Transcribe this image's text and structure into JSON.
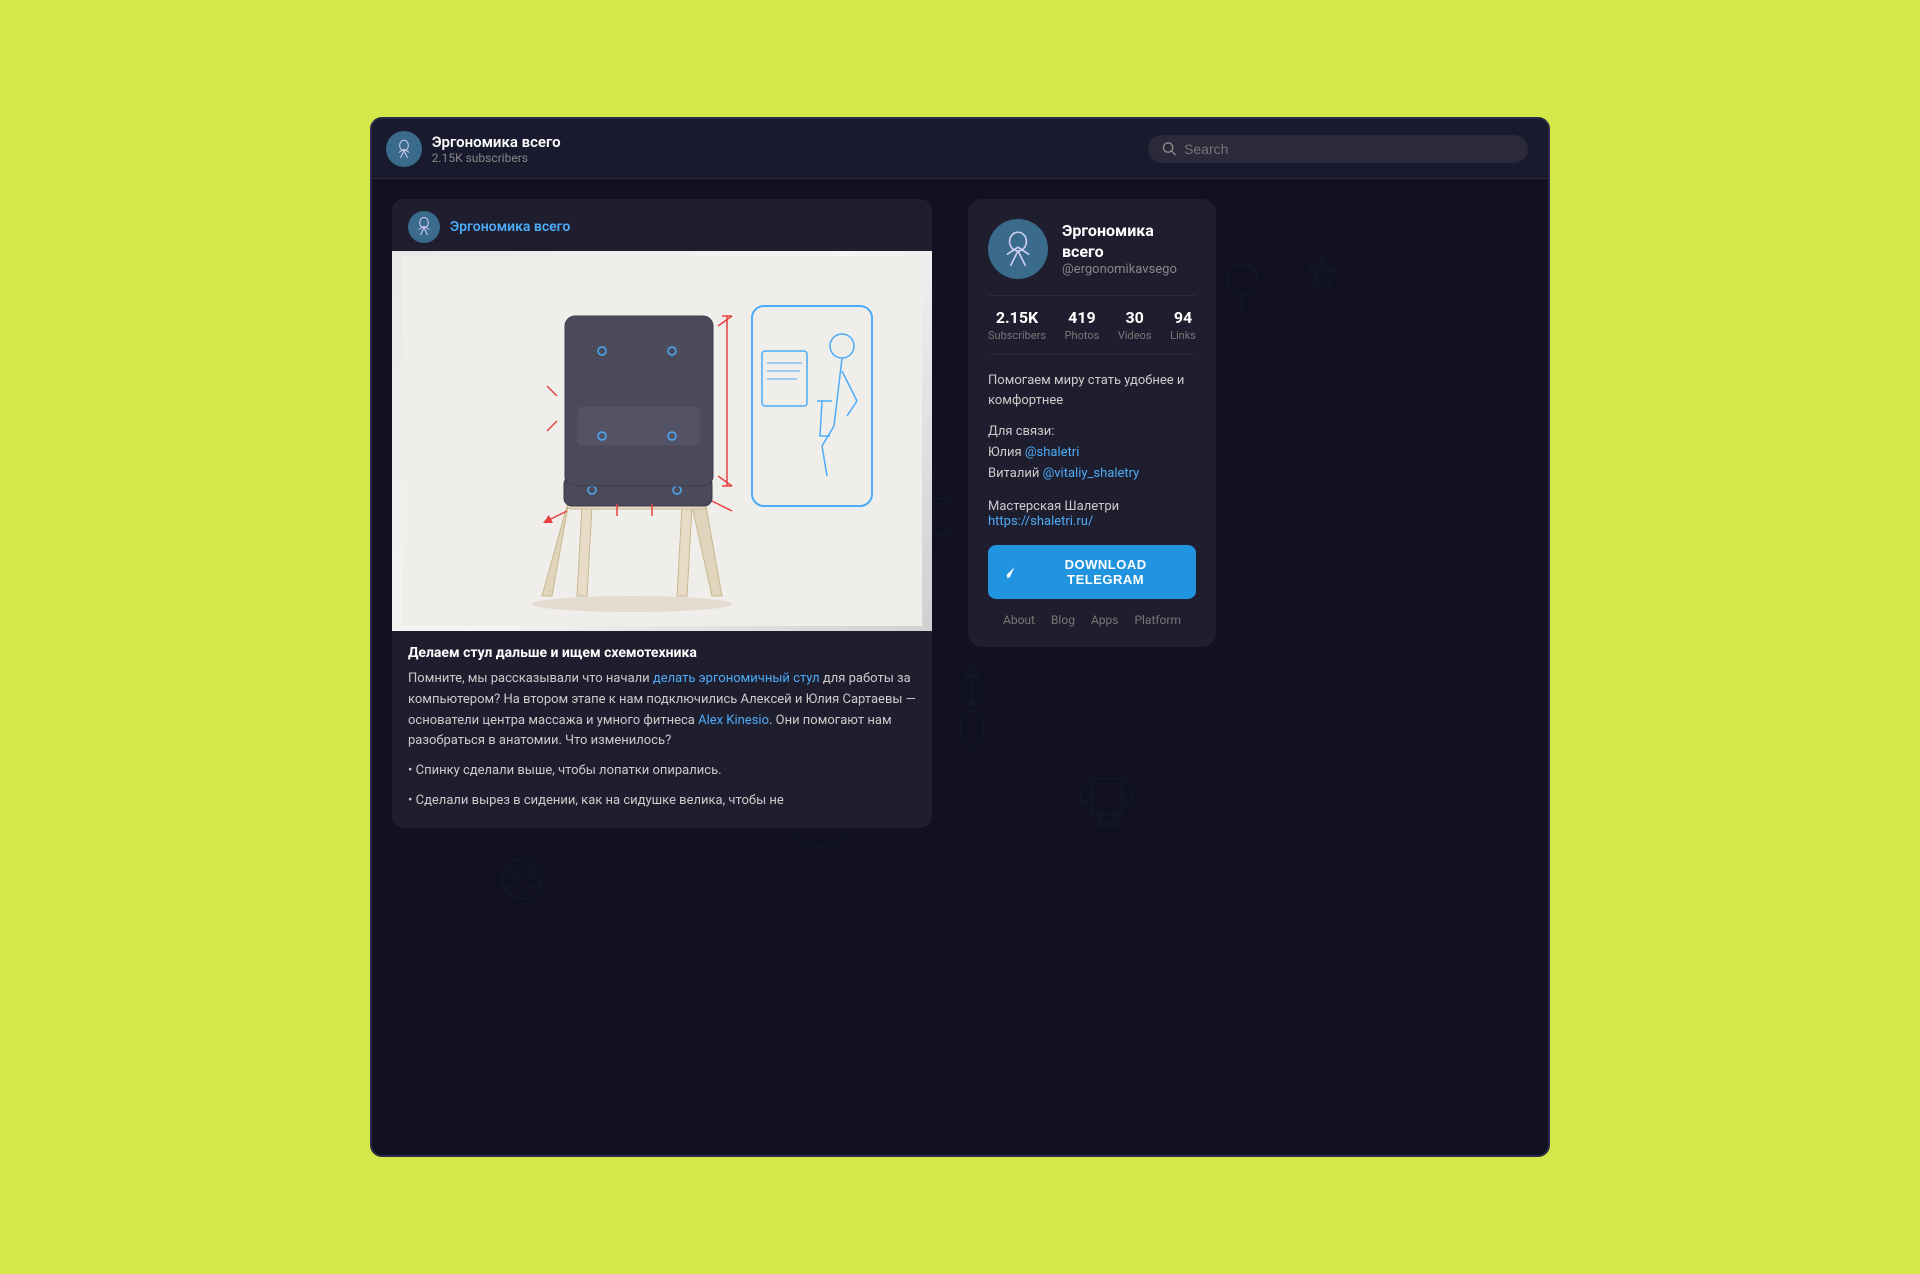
{
  "window": {
    "background": "#d4e84a"
  },
  "titlebar": {
    "channel_name": "Эргономика всего",
    "subscribers": "2.15K subscribers",
    "search_placeholder": "Search"
  },
  "post": {
    "channel_name": "Эргономика всего",
    "title": "Делаем стул дальше и ищем схемотехника",
    "body_1": "Помните, мы рассказывали что начали ",
    "link_1": "делать эргономичный стул",
    "body_2": " для работы за компьютером? На втором этапе к нам подключились Алексей и Юлия Сартаевы — основатели центра массажа и умного фитнеса ",
    "link_2": "Alex Kinesio",
    "body_3": ". Они помогают нам разобраться в анатомии. Что изменилось?",
    "bullet_1": "• Спинку сделали выше, чтобы лопатки опирались.",
    "bullet_2": "• Сделали вырез в сидении, как на сидушке велика, чтобы не"
  },
  "channel_card": {
    "name": "Эргономика всего",
    "username": "@ergonomikavsego",
    "stats": [
      {
        "value": "2.15K",
        "label": "Subscribers"
      },
      {
        "value": "419",
        "label": "Photos"
      },
      {
        "value": "30",
        "label": "Videos"
      },
      {
        "value": "94",
        "label": "Links"
      }
    ],
    "description": "Помогаем миру стать удобнее и комфортнее",
    "contact_label": "Для связи:",
    "contact_1_name": "Юлия ",
    "contact_1_link": "@shaletri",
    "contact_2_name": "Виталий ",
    "contact_2_link": "@vitaliy_shaletry",
    "workshop_text": "Мастерская Шалетри ",
    "workshop_link_text": "https://shaletri.ru/",
    "download_button": "DOWNLOAD TELEGRAM",
    "footer_links": [
      "About",
      "Blog",
      "Apps",
      "Platform"
    ]
  }
}
